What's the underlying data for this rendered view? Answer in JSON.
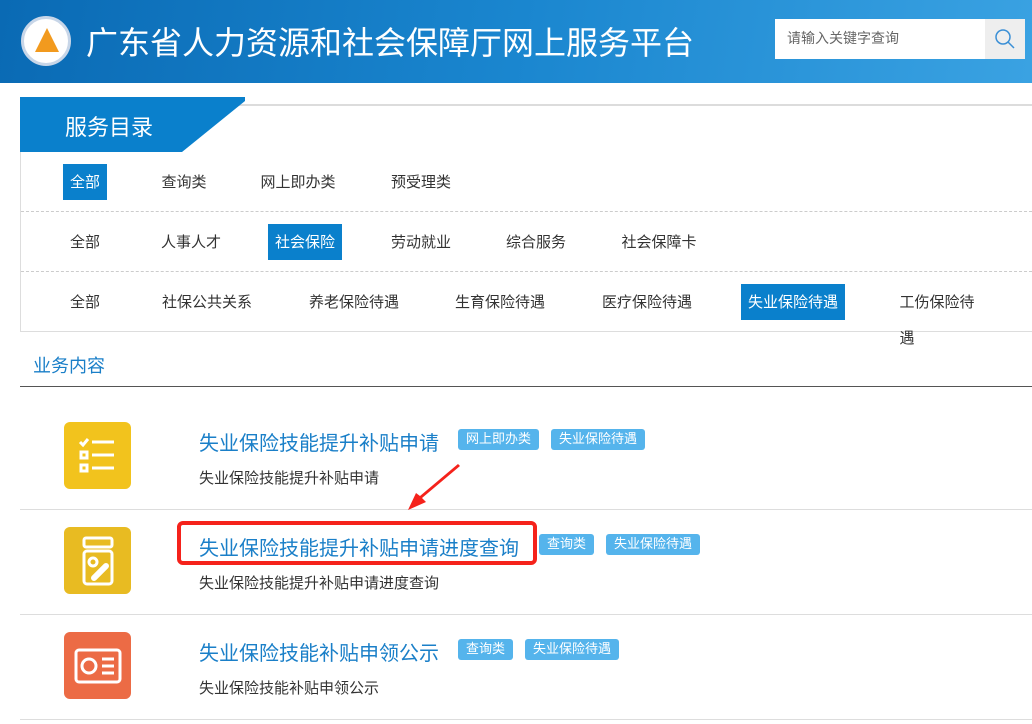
{
  "header": {
    "title": "广东省人力资源和社会保障厅网上服务平台",
    "search_placeholder": "请输入关键字查询"
  },
  "catalog": {
    "title": "服务目录",
    "row1": [
      "全部",
      "查询类",
      "网上即办类",
      "预受理类"
    ],
    "row2": [
      "全部",
      "人事人才",
      "社会保险",
      "劳动就业",
      "综合服务",
      "社会保障卡"
    ],
    "row3": [
      "全部",
      "社保公共关系",
      "养老保险待遇",
      "生育保险待遇",
      "医疗保险待遇",
      "失业保险待遇",
      "工伤保险待遇"
    ]
  },
  "section_title": "业务内容",
  "items": [
    {
      "title": "失业保险技能提升补贴申请",
      "tags": [
        "网上即办类",
        "失业保险待遇"
      ],
      "desc": "失业保险技能提升补贴申请",
      "color": "#f2c31d"
    },
    {
      "title": "失业保险技能提升补贴申请进度查询",
      "tags": [
        "查询类",
        "失业保险待遇"
      ],
      "desc": "失业保险技能提升补贴申请进度查询",
      "color": "#e8bb22"
    },
    {
      "title": "失业保险技能补贴申领公示",
      "tags": [
        "查询类",
        "失业保险待遇"
      ],
      "desc": "失业保险技能补贴申领公示",
      "color": "#ec6b45"
    }
  ],
  "colors": {
    "brand": "#0a80cc",
    "tag": "#55b4ec",
    "highlight": "#f5221b"
  }
}
